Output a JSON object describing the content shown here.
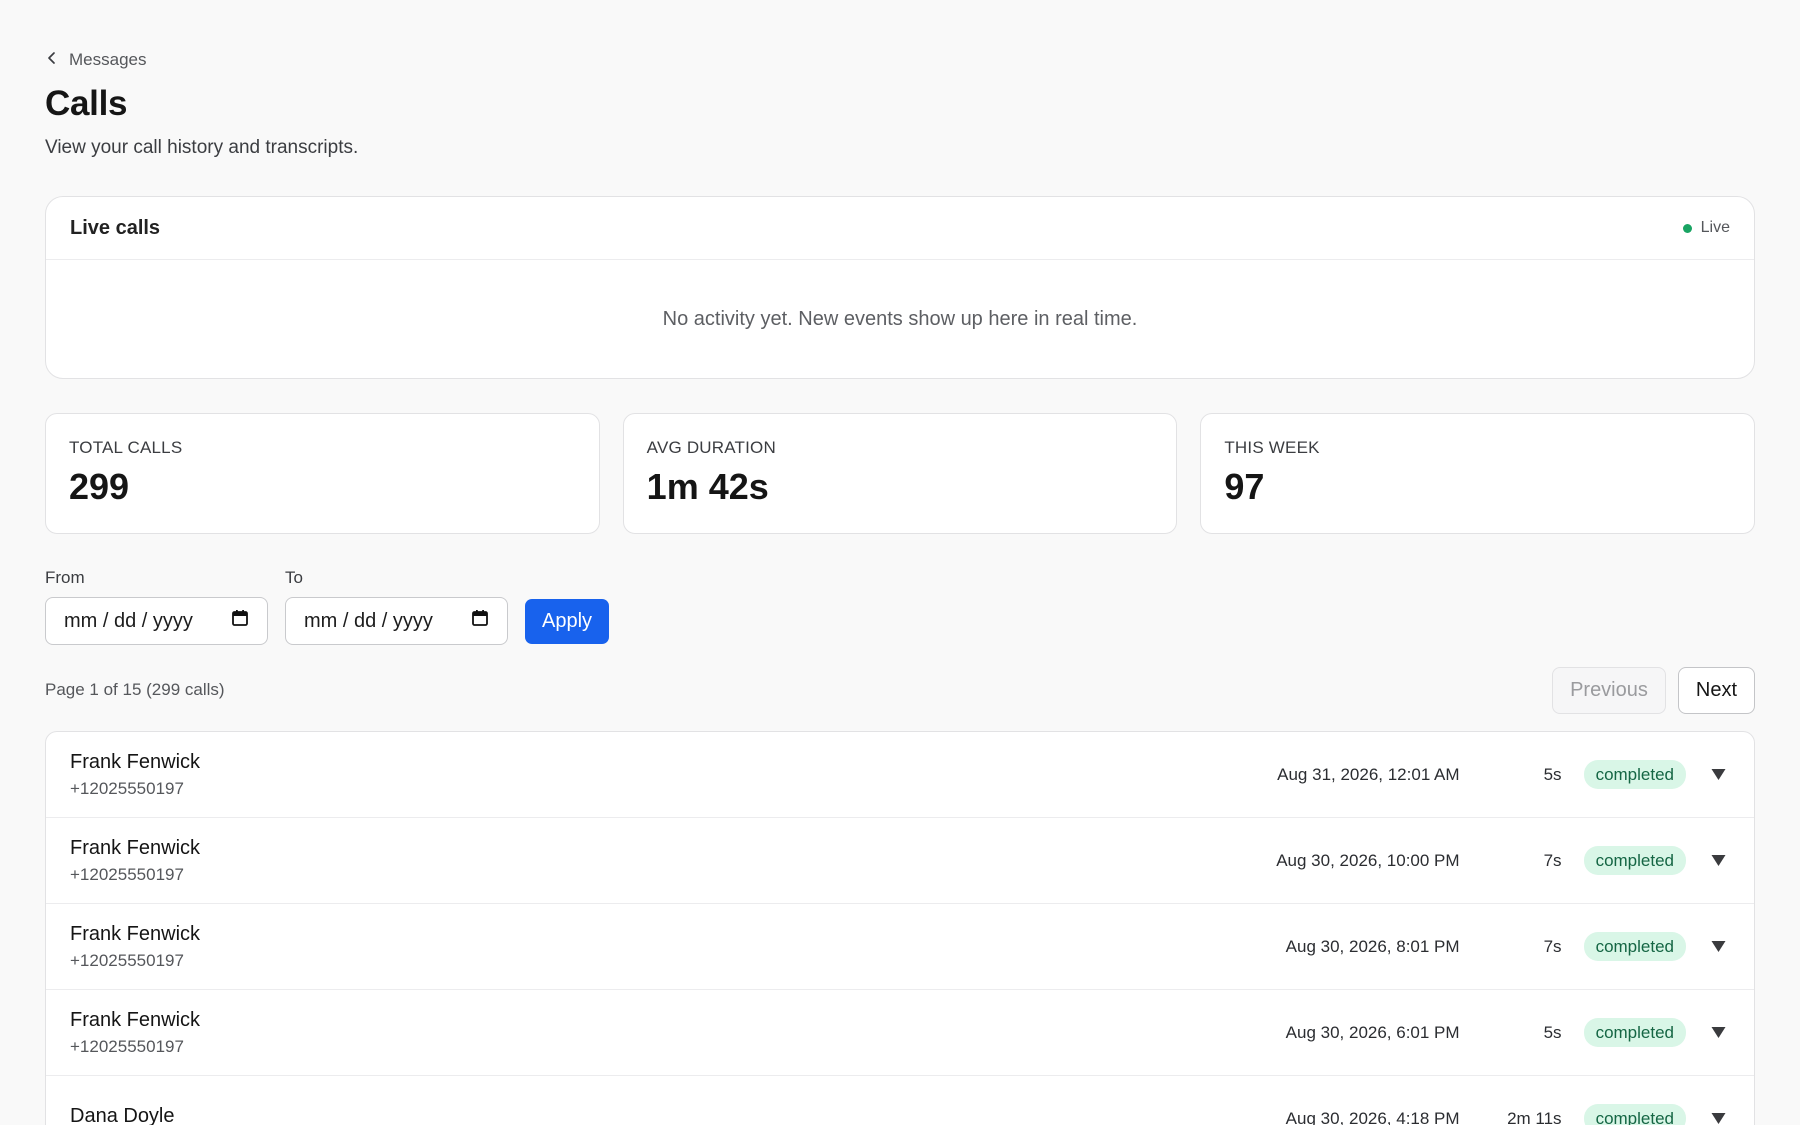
{
  "nav": {
    "back_label": "Messages"
  },
  "header": {
    "title": "Calls",
    "subtitle": "View your call history and transcripts."
  },
  "live": {
    "title": "Live calls",
    "status": "Live",
    "empty_text": "No activity yet. New events show up here in real time.",
    "status_color": "#19a463"
  },
  "stats": [
    {
      "label": "TOTAL CALLS",
      "value": "299"
    },
    {
      "label": "AVG DURATION",
      "value": "1m 42s"
    },
    {
      "label": "THIS WEEK",
      "value": "97"
    }
  ],
  "filters": {
    "from_label": "From",
    "to_label": "To",
    "from_value": "mm / dd / yyyy",
    "to_value": "mm / dd / yyyy",
    "apply_label": "Apply"
  },
  "pagination": {
    "info": "Page 1 of 15 (299 calls)",
    "previous_label": "Previous",
    "next_label": "Next"
  },
  "calls": [
    {
      "name": "Frank Fenwick",
      "phone": "+12025550197",
      "time": "Aug 31, 2026, 12:01 AM",
      "duration": "5s",
      "status": "completed"
    },
    {
      "name": "Frank Fenwick",
      "phone": "+12025550197",
      "time": "Aug 30, 2026, 10:00 PM",
      "duration": "7s",
      "status": "completed"
    },
    {
      "name": "Frank Fenwick",
      "phone": "+12025550197",
      "time": "Aug 30, 2026, 8:01 PM",
      "duration": "7s",
      "status": "completed"
    },
    {
      "name": "Frank Fenwick",
      "phone": "+12025550197",
      "time": "Aug 30, 2026, 6:01 PM",
      "duration": "5s",
      "status": "completed"
    },
    {
      "name": "Dana Doyle",
      "phone": "",
      "time": "Aug 30, 2026, 4:18 PM",
      "duration": "2m 11s",
      "status": "completed"
    }
  ],
  "colors": {
    "accent": "#1862ed",
    "status_completed_bg": "#d9f6e7",
    "status_completed_text": "#156644"
  },
  "icons": {
    "back": "chevron-left-icon",
    "calendar": "calendar-icon",
    "expand": "triangle-down-icon"
  }
}
